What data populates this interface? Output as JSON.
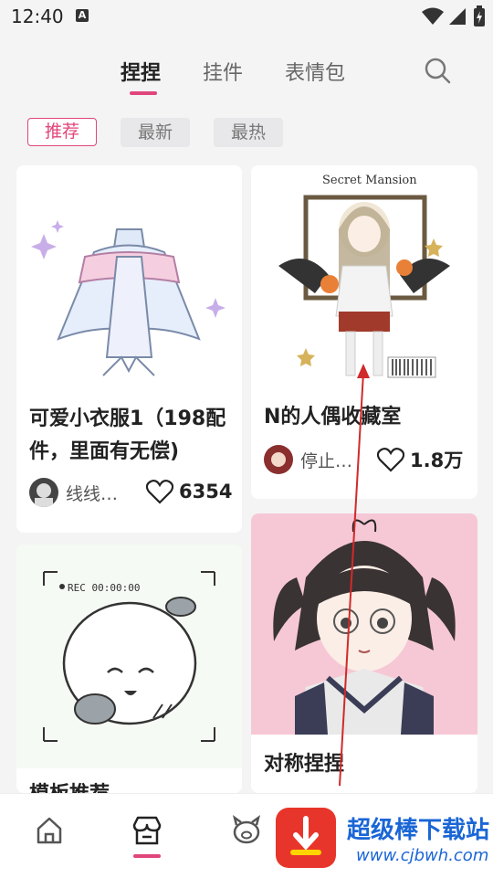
{
  "status_bar": {
    "time": "12:40",
    "notif_icon": "A"
  },
  "top_nav": {
    "tabs": [
      {
        "label": "捏捏",
        "active": true
      },
      {
        "label": "挂件",
        "active": false
      },
      {
        "label": "表情包",
        "active": false
      }
    ]
  },
  "filters": [
    {
      "label": "推荐",
      "active": true
    },
    {
      "label": "最新",
      "active": false
    },
    {
      "label": "最热",
      "active": false
    }
  ],
  "cards": [
    {
      "title": "可爱小衣服1（198配件，里面有无偿)",
      "author": "线线…",
      "likes": "6354"
    },
    {
      "title": "N的人偶收藏室",
      "author": "停止…",
      "likes": "1.8万",
      "image_text": "Secret Mansion"
    },
    {
      "title": "模板推荐",
      "image_text": "REC 00:00:00"
    },
    {
      "title": "对称捏捏"
    }
  ],
  "bottom_nav": [
    "home-icon",
    "store-icon",
    "pig-icon"
  ],
  "watermark": {
    "text": "超级棒下载站",
    "url": "www.cjbwh.com"
  },
  "colors": {
    "accent": "#e0457b",
    "background": "#f4f4f5",
    "pink_card_bg": "#f6c8d6"
  }
}
